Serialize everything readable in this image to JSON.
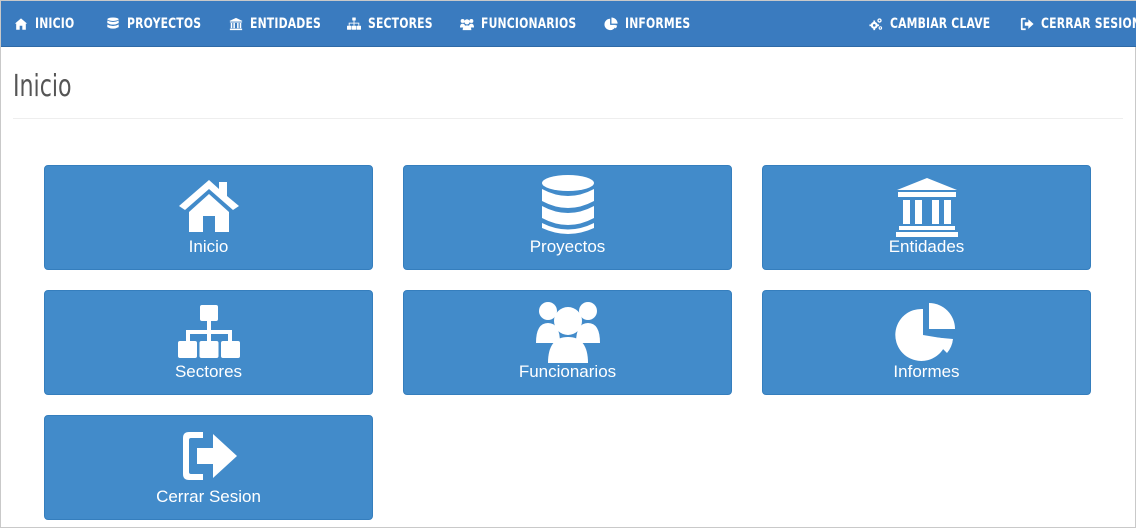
{
  "nav": {
    "left": [
      {
        "label": "INICIO",
        "icon": "home-icon"
      },
      {
        "label": "PROYECTOS",
        "icon": "database-icon"
      },
      {
        "label": "ENTIDADES",
        "icon": "bank-icon"
      },
      {
        "label": "SECTORES",
        "icon": "sitemap-icon"
      },
      {
        "label": "FUNCIONARIOS",
        "icon": "users-icon"
      },
      {
        "label": "INFORMES",
        "icon": "pie-chart-icon"
      }
    ],
    "right": [
      {
        "label": "CAMBIAR CLAVE",
        "icon": "cogs-icon"
      },
      {
        "label": "CERRAR SESION",
        "icon": "sign-out-icon"
      }
    ]
  },
  "page": {
    "title": "Inicio"
  },
  "tiles": [
    {
      "label": "Inicio",
      "icon": "home-icon"
    },
    {
      "label": "Proyectos",
      "icon": "database-icon"
    },
    {
      "label": "Entidades",
      "icon": "bank-icon"
    },
    {
      "label": "Sectores",
      "icon": "sitemap-icon"
    },
    {
      "label": "Funcionarios",
      "icon": "users-icon"
    },
    {
      "label": "Informes",
      "icon": "pie-chart-icon"
    },
    {
      "label": "Cerrar Sesion",
      "icon": "sign-out-icon"
    }
  ],
  "colors": {
    "navbar": "#3a7bbf",
    "tile": "#428bca",
    "tile_border": "#357ebd",
    "title_text": "#555555"
  }
}
